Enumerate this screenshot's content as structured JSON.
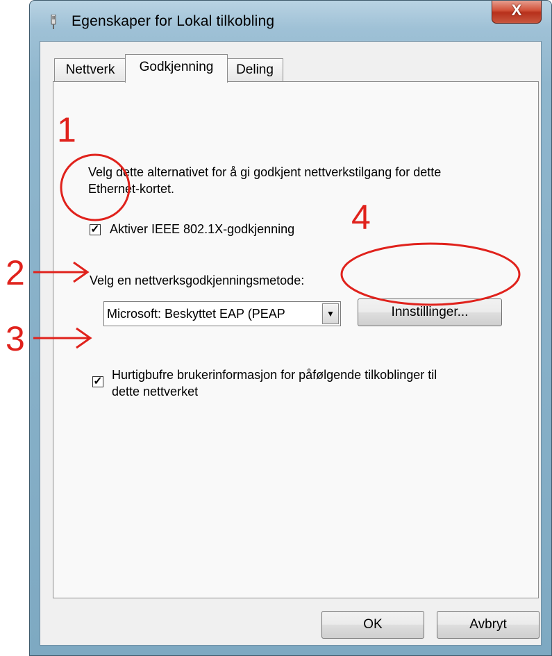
{
  "window": {
    "title": "Egenskaper for Lokal tilkobling",
    "close_label": "X"
  },
  "tabs": [
    {
      "label": "Nettverk",
      "active": false
    },
    {
      "label": "Godkjenning",
      "active": true
    },
    {
      "label": "Deling",
      "active": false
    }
  ],
  "panel": {
    "intro_text": "Velg dette alternativet for å gi godkjent nettverkstilgang for dette Ethernet-kortet.",
    "enable_checkbox": {
      "label": "Aktiver IEEE 802.1X-godkjenning",
      "checked": true
    },
    "method_label": "Velg en nettverksgodkjenningsmetode:",
    "method_select": {
      "value": "Microsoft: Beskyttet EAP (PEAP"
    },
    "settings_button": "Innstillinger...",
    "cache_checkbox": {
      "label": "Hurtigbufre brukerinformasjon for påfølgende tilkoblinger til dette nettverket",
      "checked": true
    }
  },
  "footer": {
    "ok_label": "OK",
    "cancel_label": "Avbryt"
  },
  "annotations": {
    "numbers": [
      "1",
      "2",
      "3",
      "4"
    ],
    "color": "#e0221c"
  },
  "colors": {
    "titlebar": "#9fc1d6",
    "close_button": "#c8432b",
    "dialog_bg": "#f0f0f0"
  }
}
